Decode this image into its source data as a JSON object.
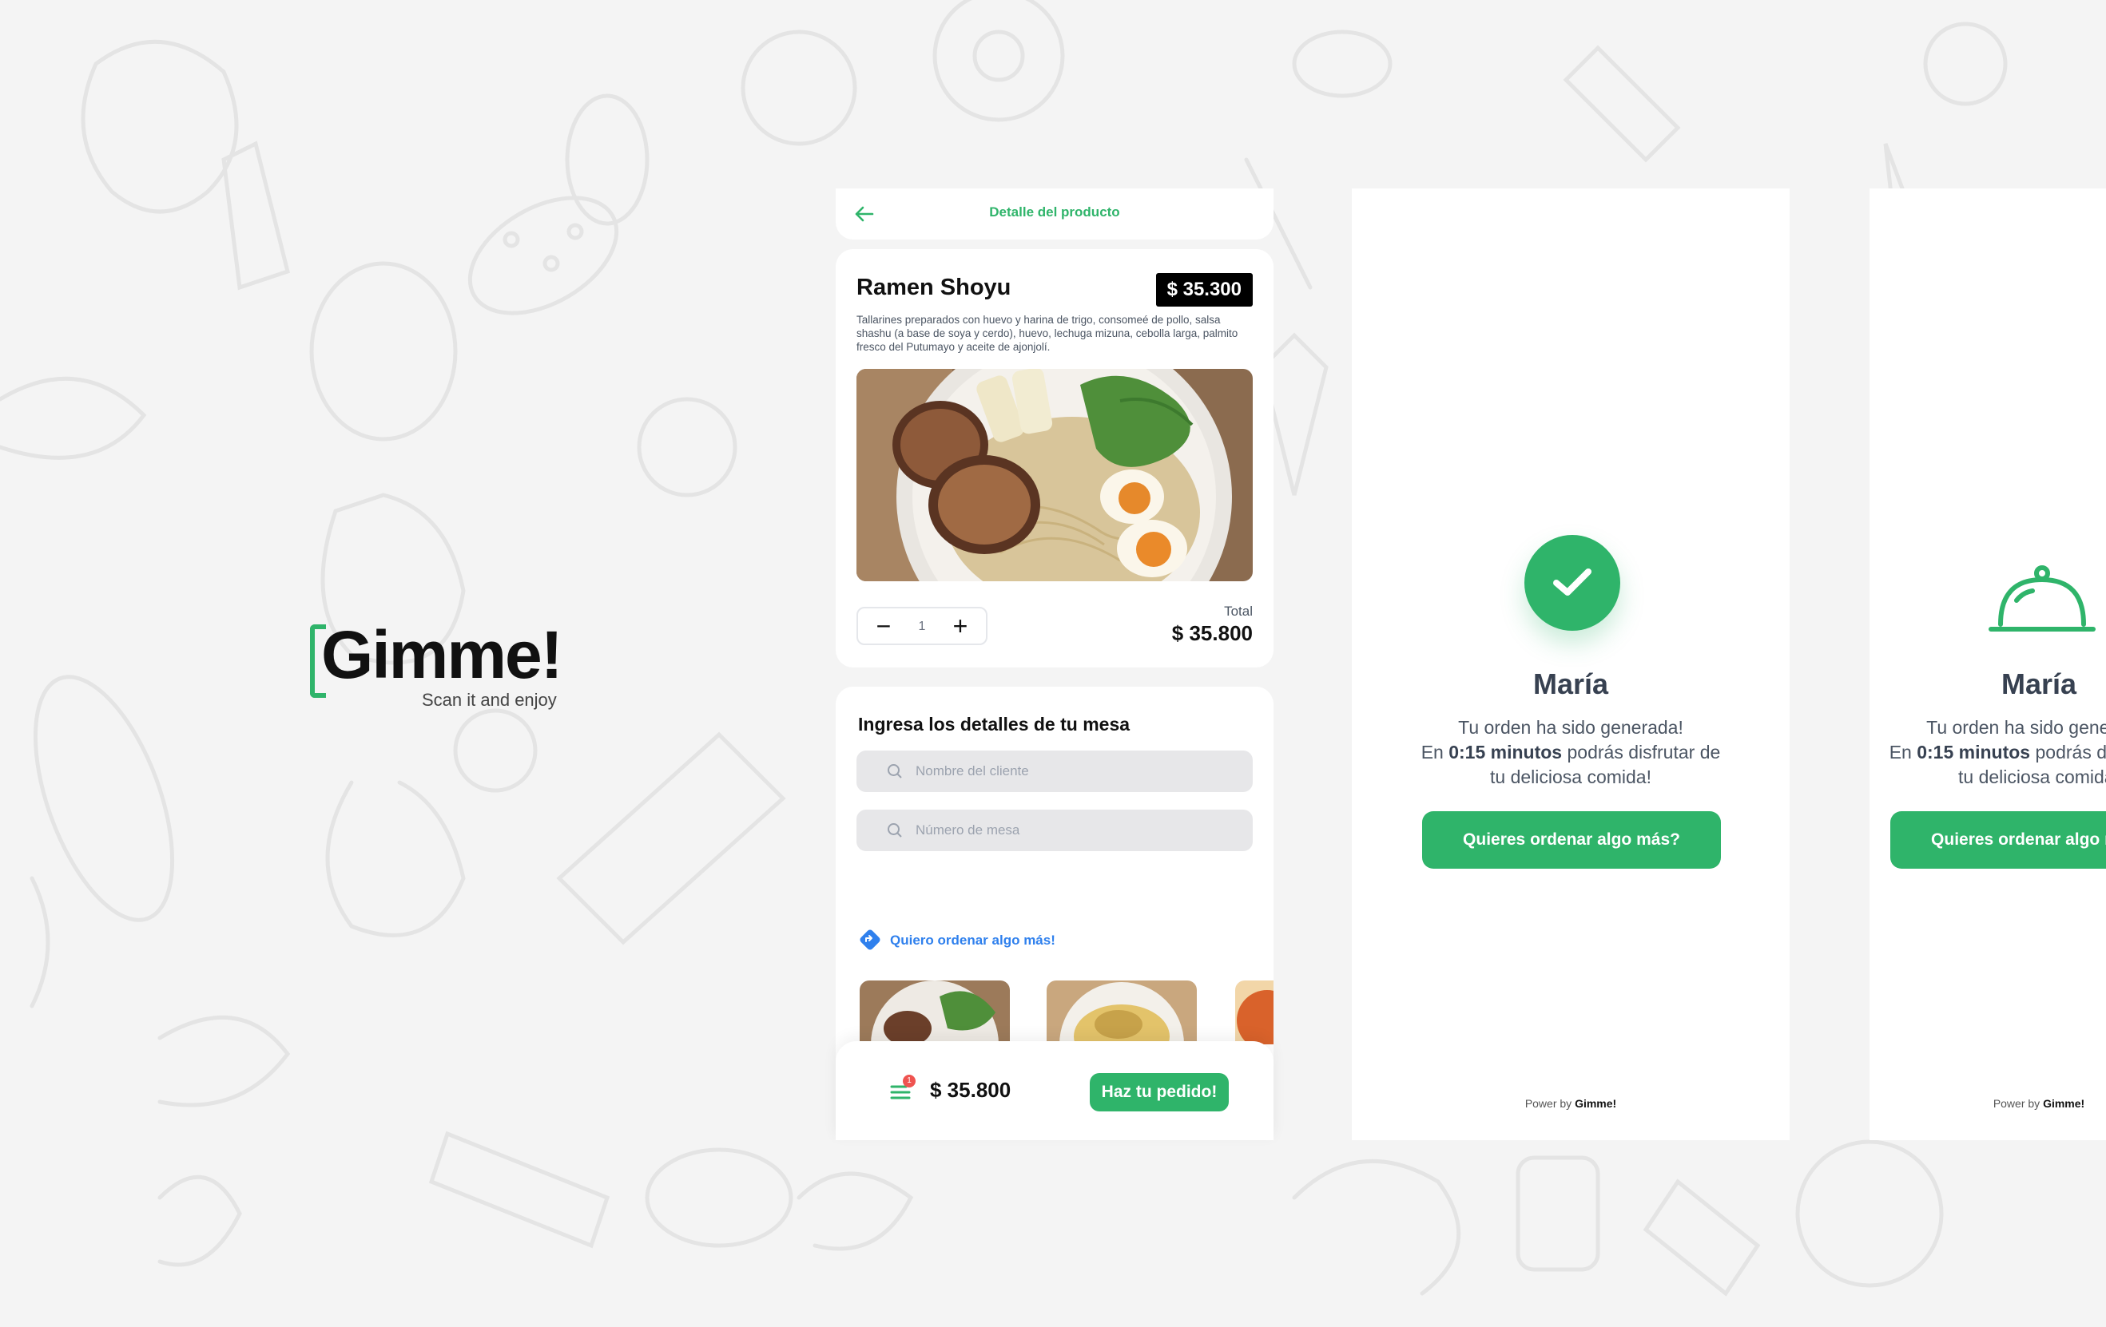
{
  "brand": {
    "name": "Gimme!",
    "tagline": "Scan it and enjoy",
    "accent": "#2fb46a"
  },
  "product_screen": {
    "header_title": "Detalle del producto",
    "back_icon": "arrow-left-icon",
    "product": {
      "name": "Ramen Shoyu",
      "price": "$ 35.300",
      "description": "Tallarines preparados con huevo y harina de trigo, consomeé de pollo, salsa shashu (a base de soya y cerdo), huevo, lechuga mizuna, cebolla larga, palmito fresco del Putumayo y aceite de ajonjolí.",
      "quantity": "1",
      "total_label": "Total",
      "total_value": "$ 35.800"
    },
    "table_details": {
      "title": "Ingresa los detalles de tu mesa",
      "client_placeholder": "Nombre del cliente",
      "table_placeholder": "Número de mesa",
      "more_link": "Quiero ordenar algo más!"
    },
    "bottom_bar": {
      "cart_count": "1",
      "sum": "$ 35.800",
      "order_button": "Haz tu pedido!"
    }
  },
  "confirmation_screens": [
    {
      "name": "María",
      "line1": "Tu orden ha sido generada!",
      "line2_prefix": "En ",
      "line2_bold": "0:15 minutos",
      "line2_suffix": " podrás disfrutar de",
      "line3": "tu deliciosa comida!",
      "button": "Quieres ordenar algo más?",
      "power_prefix": "Power by ",
      "power_brand": "Gimme!",
      "icon": "check-icon"
    },
    {
      "name": "María",
      "line1": "Tu orden ha sido generada!",
      "line2_prefix": "En ",
      "line2_bold": "0:15 minutos",
      "line2_suffix": " podrás disfrutar de",
      "line3": "tu deliciosa comida!",
      "button": "Quieres ordenar algo más?",
      "power_prefix": "Power by ",
      "power_brand": "Gimme!",
      "icon": "cloche-icon"
    }
  ]
}
